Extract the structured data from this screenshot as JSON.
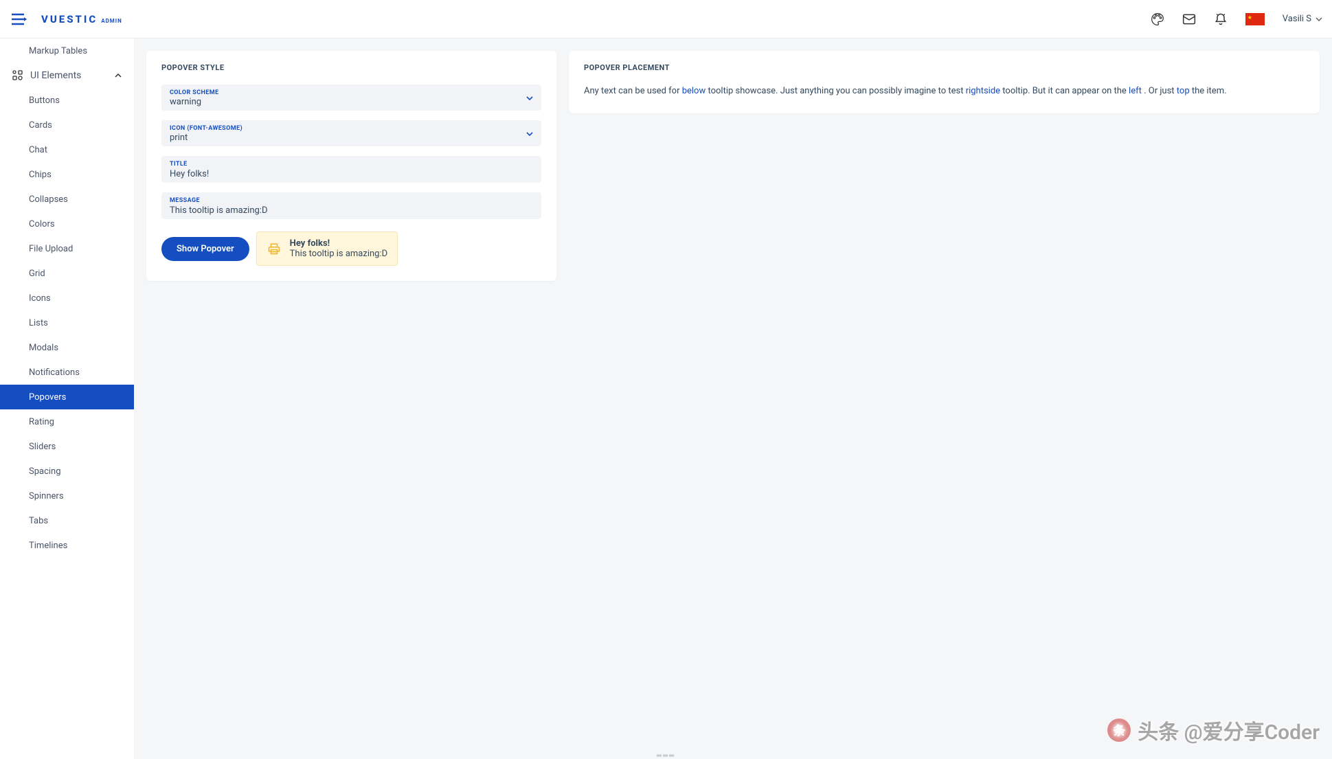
{
  "header": {
    "logo_main": "VUESTIC",
    "logo_suffix": "ADMIN",
    "user_name": "Vasili S"
  },
  "sidebar": {
    "items": [
      {
        "label": "Markup Tables",
        "indent": true
      },
      {
        "label": "UI Elements",
        "topLevel": true,
        "expanded": true
      },
      {
        "label": "Buttons",
        "indent": true
      },
      {
        "label": "Cards",
        "indent": true
      },
      {
        "label": "Chat",
        "indent": true
      },
      {
        "label": "Chips",
        "indent": true
      },
      {
        "label": "Collapses",
        "indent": true
      },
      {
        "label": "Colors",
        "indent": true
      },
      {
        "label": "File Upload",
        "indent": true
      },
      {
        "label": "Grid",
        "indent": true
      },
      {
        "label": "Icons",
        "indent": true
      },
      {
        "label": "Lists",
        "indent": true
      },
      {
        "label": "Modals",
        "indent": true
      },
      {
        "label": "Notifications",
        "indent": true
      },
      {
        "label": "Popovers",
        "indent": true,
        "active": true
      },
      {
        "label": "Rating",
        "indent": true
      },
      {
        "label": "Sliders",
        "indent": true
      },
      {
        "label": "Spacing",
        "indent": true
      },
      {
        "label": "Spinners",
        "indent": true
      },
      {
        "label": "Tabs",
        "indent": true
      },
      {
        "label": "Timelines",
        "indent": true
      }
    ]
  },
  "popoverStyle": {
    "card_title": "POPOVER STYLE",
    "color_scheme_label": "COLOR SCHEME",
    "color_scheme_value": "warning",
    "icon_label": "ICON (FONT-AWESOME)",
    "icon_value": "print",
    "title_label": "TITLE",
    "title_value": "Hey folks!",
    "message_label": "MESSAGE",
    "message_value": "This tooltip is amazing:D",
    "button_label": "Show Popover",
    "demo_title": "Hey folks!",
    "demo_message": "This tooltip is amazing:D"
  },
  "popoverPlacement": {
    "card_title": "POPOVER PLACEMENT",
    "t1": "Any text can be used for ",
    "l1": "below",
    "t2": " tooltip showcase. Just anything you can possibly imagine to test ",
    "l2": "rightside",
    "t3": " tooltip. But it can appear on the ",
    "l3": "left",
    "t4": " . Or just ",
    "l4": "top",
    "t5": " the item."
  },
  "watermark": "头条 @爱分享Coder"
}
